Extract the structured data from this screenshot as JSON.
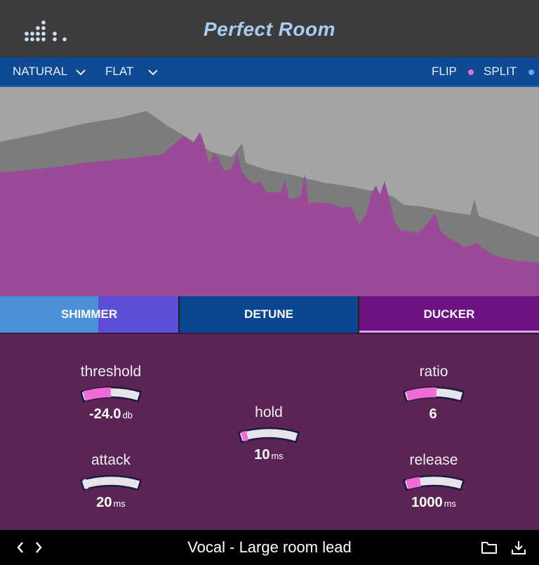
{
  "app": {
    "title": "Perfect Room"
  },
  "toolbar": {
    "mode_label": "NATURAL",
    "curve_label": "FLAT",
    "flip_label": "FLIP",
    "split_label": "SPLIT",
    "flip_dot_color": "#f06bd6",
    "split_dot_color": "#5aa6f2"
  },
  "tabs": [
    {
      "label": "SHIMMER"
    },
    {
      "label": "DETUNE"
    },
    {
      "label": "DUCKER",
      "active": true
    }
  ],
  "ducker": {
    "threshold": {
      "label": "threshold",
      "value": "-24.0",
      "unit": "db",
      "fill": 0.5
    },
    "attack": {
      "label": "attack",
      "value": "20",
      "unit": "ms",
      "fill": 0.0
    },
    "hold": {
      "label": "hold",
      "value": "10",
      "unit": "ms",
      "fill": 0.1
    },
    "ratio": {
      "label": "ratio",
      "value": "6",
      "unit": "",
      "fill": 0.55
    },
    "release": {
      "label": "release",
      "value": "1000",
      "unit": "ms",
      "fill": 0.25
    }
  },
  "footer": {
    "preset_name": "Vocal - Large room lead"
  },
  "colors": {
    "knob_fill": "#f06bd6",
    "knob_track": "#e6e4ea",
    "knob_outline": "#1a1a40",
    "spectrum_wet": "#9b4a98",
    "spectrum_dry": "#7c7c7c"
  },
  "icons": [
    "logo-dots-icon",
    "chevron-down-icon",
    "prev-icon",
    "next-icon",
    "folder-icon",
    "download-icon"
  ]
}
